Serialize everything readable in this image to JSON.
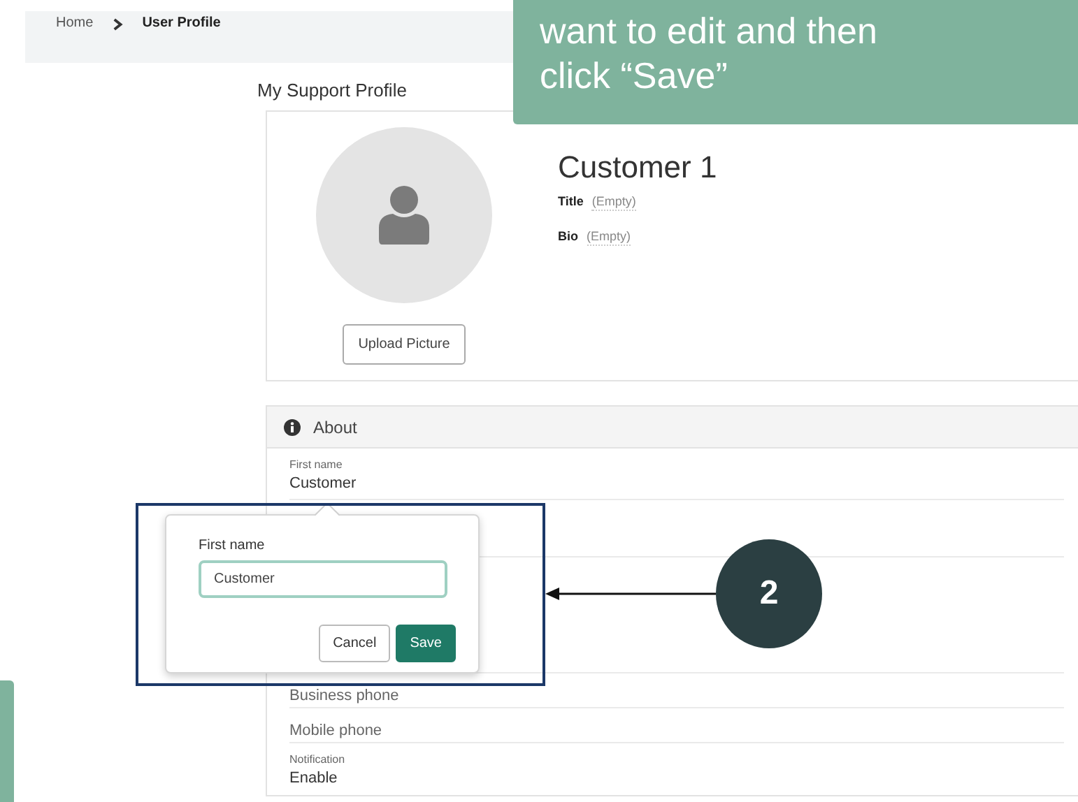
{
  "breadcrumb": [
    {
      "label": "Home",
      "current": false
    },
    {
      "label": "User Profile",
      "current": true
    }
  ],
  "page_title": "My Support Profile",
  "profile": {
    "name": "Customer 1",
    "upload_button": "Upload Picture",
    "fields": [
      {
        "label": "Title",
        "value": "(Empty)"
      },
      {
        "label": "Bio",
        "value": "(Empty)"
      }
    ]
  },
  "about": {
    "title": "About",
    "rows": [
      {
        "kind": "value",
        "label": "First name",
        "value": "Customer"
      },
      {
        "kind": "hidden"
      },
      {
        "kind": "hidden"
      },
      {
        "kind": "empty",
        "label": "Business phone"
      },
      {
        "kind": "empty",
        "label": "Mobile phone"
      },
      {
        "kind": "value",
        "label": "Notification",
        "value": "Enable"
      }
    ]
  },
  "popover": {
    "label": "First name",
    "value": "Customer",
    "buttons": [
      {
        "label": "Cancel",
        "kind": "secondary"
      },
      {
        "label": "Save",
        "kind": "primary"
      }
    ]
  },
  "callout": {
    "lines": [
      "want to edit and then",
      "click “Save”"
    ]
  },
  "step_marker": "2"
}
